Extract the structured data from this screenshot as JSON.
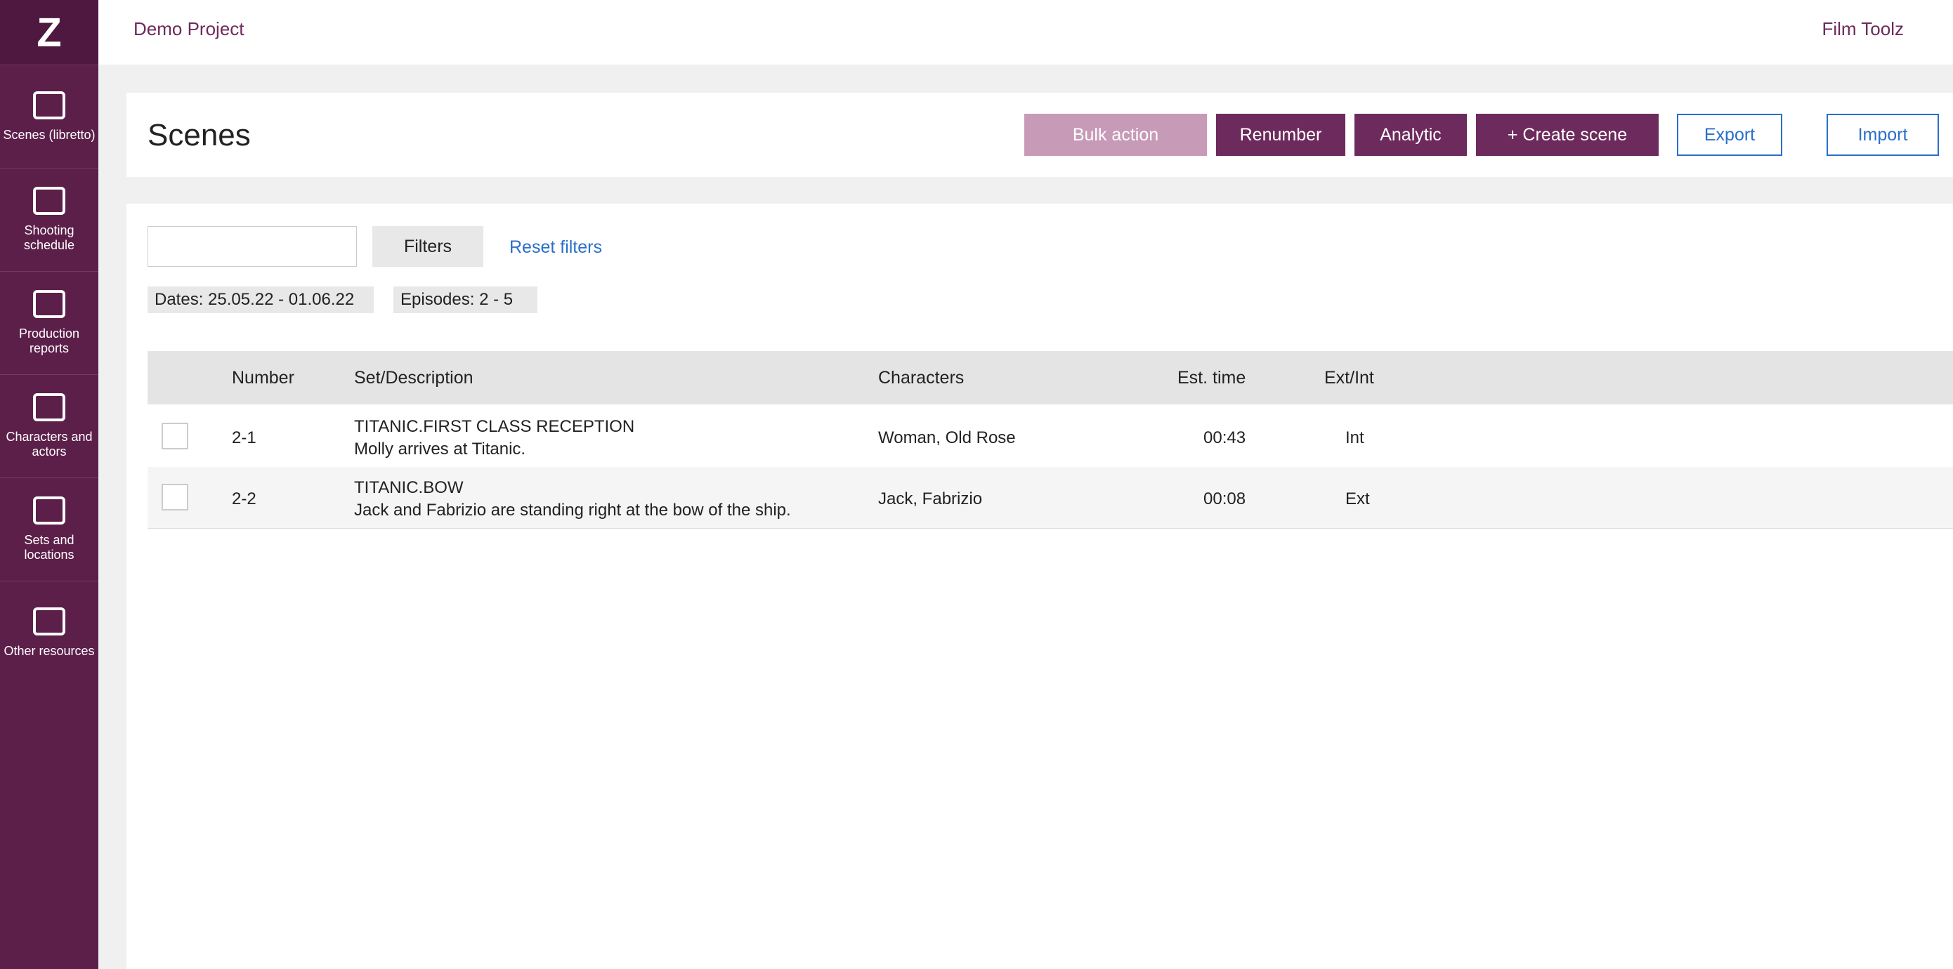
{
  "app": {
    "logo": "Z"
  },
  "sidebar": {
    "items": [
      {
        "label": "Scenes (libretto)",
        "icon": "clapperboard-icon"
      },
      {
        "label": "Shooting schedule",
        "icon": "calendar-icon"
      },
      {
        "label": "Production reports",
        "icon": "checkbox-icon"
      },
      {
        "label": "Characters and actors",
        "icon": "users-icon"
      },
      {
        "label": "Sets and locations",
        "icon": "image-icon"
      },
      {
        "label": "Other resources",
        "icon": "archive-icon"
      }
    ]
  },
  "topbar": {
    "project": "Demo Project",
    "user": "Film Toolz"
  },
  "page": {
    "title": "Scenes"
  },
  "toolbar": {
    "bulk": "Bulk action",
    "renumber": "Renumber",
    "analytic": "Analytic",
    "create": "+ Create scene",
    "export": "Export",
    "import": "Import"
  },
  "filters": {
    "button": "Filters",
    "reset": "Reset filters",
    "chip1": "Dates: 25.05.22 - 01.06.22",
    "chip2": "Episodes: 2 - 5"
  },
  "table": {
    "headers": [
      "Number",
      "Set/Description",
      "Characters",
      "Est. time",
      "Ext/Int"
    ],
    "rows": [
      {
        "number": "2-1",
        "set": "TITANIC.FIRST CLASS RECEPTION",
        "desc": "Molly arrives at Titanic.",
        "characters": "Woman, Old Rose",
        "time": "00:43",
        "ext": "Int"
      },
      {
        "number": "2-2",
        "set": "TITANIC.BOW",
        "desc": "Jack and Fabrizio are standing right at the bow of the ship.",
        "characters": "Jaсk, Fabrizio",
        "time": "00:08",
        "ext": "Ext"
      }
    ]
  }
}
